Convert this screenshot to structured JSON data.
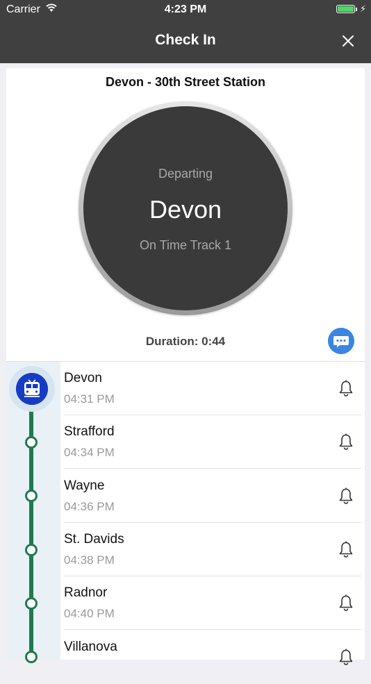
{
  "status_bar": {
    "carrier": "Carrier",
    "time": "4:23 PM"
  },
  "nav": {
    "title": "Check In"
  },
  "trip": {
    "title": "Devon - 30th Street Station",
    "status_circle": {
      "label": "Departing",
      "station": "Devon",
      "status": "On Time Track 1"
    },
    "duration": "Duration: 0:44"
  },
  "stops": [
    {
      "name": "Devon",
      "time": "04:31 PM"
    },
    {
      "name": "Strafford",
      "time": "04:34 PM"
    },
    {
      "name": "Wayne",
      "time": "04:36 PM"
    },
    {
      "name": "St. Davids",
      "time": "04:38 PM"
    },
    {
      "name": "Radnor",
      "time": "04:40 PM"
    },
    {
      "name": "Villanova",
      "time": ""
    }
  ],
  "icons": {
    "wifi": "wifi-icon",
    "battery": "battery-icon",
    "close": "close-icon",
    "chat": "chat-bubble-icon",
    "train": "train-icon",
    "bell": "bell-icon"
  },
  "colors": {
    "nav_bar": "#404040",
    "line_green": "#1f7a4d",
    "chat_blue": "#3b86e0",
    "train_blue": "#173cc4",
    "circle_dark": "#3a3a3a"
  }
}
